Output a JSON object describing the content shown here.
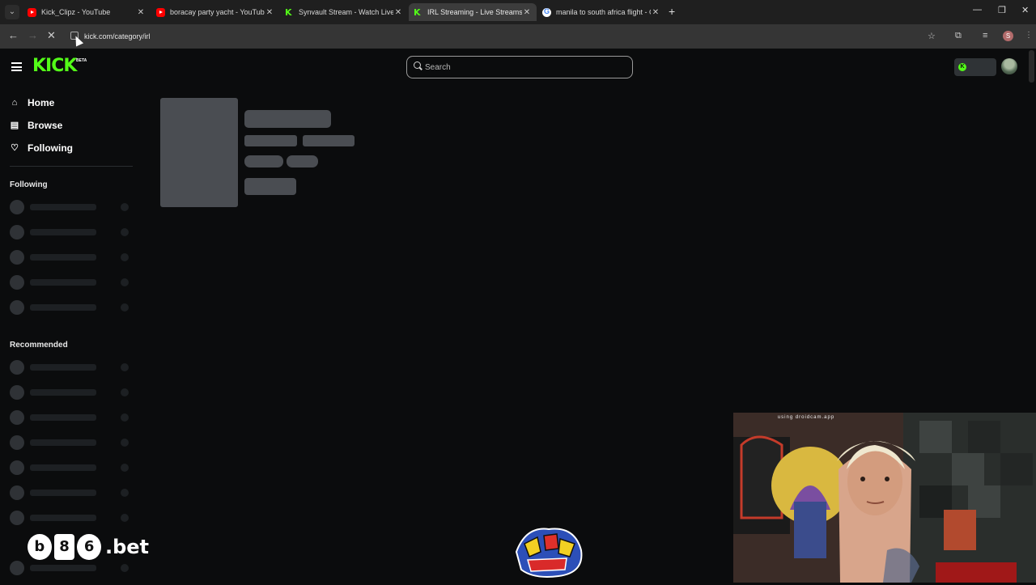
{
  "browser": {
    "tabs": [
      {
        "title": "Kick_Clipz - YouTube",
        "favicon": "youtube-icon",
        "active": false
      },
      {
        "title": "boracay party yacht - YouTube",
        "favicon": "youtube-icon",
        "active": false
      },
      {
        "title": "Synvault Stream - Watch Live o",
        "favicon": "kick-icon",
        "active": false
      },
      {
        "title": "IRL Streaming - Live Streams o",
        "favicon": "kick-icon",
        "active": true
      },
      {
        "title": "manila to south africa flight - G",
        "favicon": "google-icon",
        "active": false
      }
    ],
    "url": "kick.com/category/irl",
    "profile_initial": "S"
  },
  "kick": {
    "logo": "KICK",
    "logo_badge": "BETA",
    "search_placeholder": "Search",
    "nav": [
      {
        "label": "Home",
        "icon": "home-icon"
      },
      {
        "label": "Browse",
        "icon": "browse-icon"
      },
      {
        "label": "Following",
        "icon": "heart-icon"
      }
    ],
    "following_title": "Following",
    "recommended_title": "Recommended",
    "brand_color": "#53fc18"
  },
  "overlays": {
    "sponsor_glyphs": [
      "b",
      "8",
      "6"
    ],
    "sponsor_suffix": ".bet",
    "webcam_watermark": "using droidcam.app"
  }
}
